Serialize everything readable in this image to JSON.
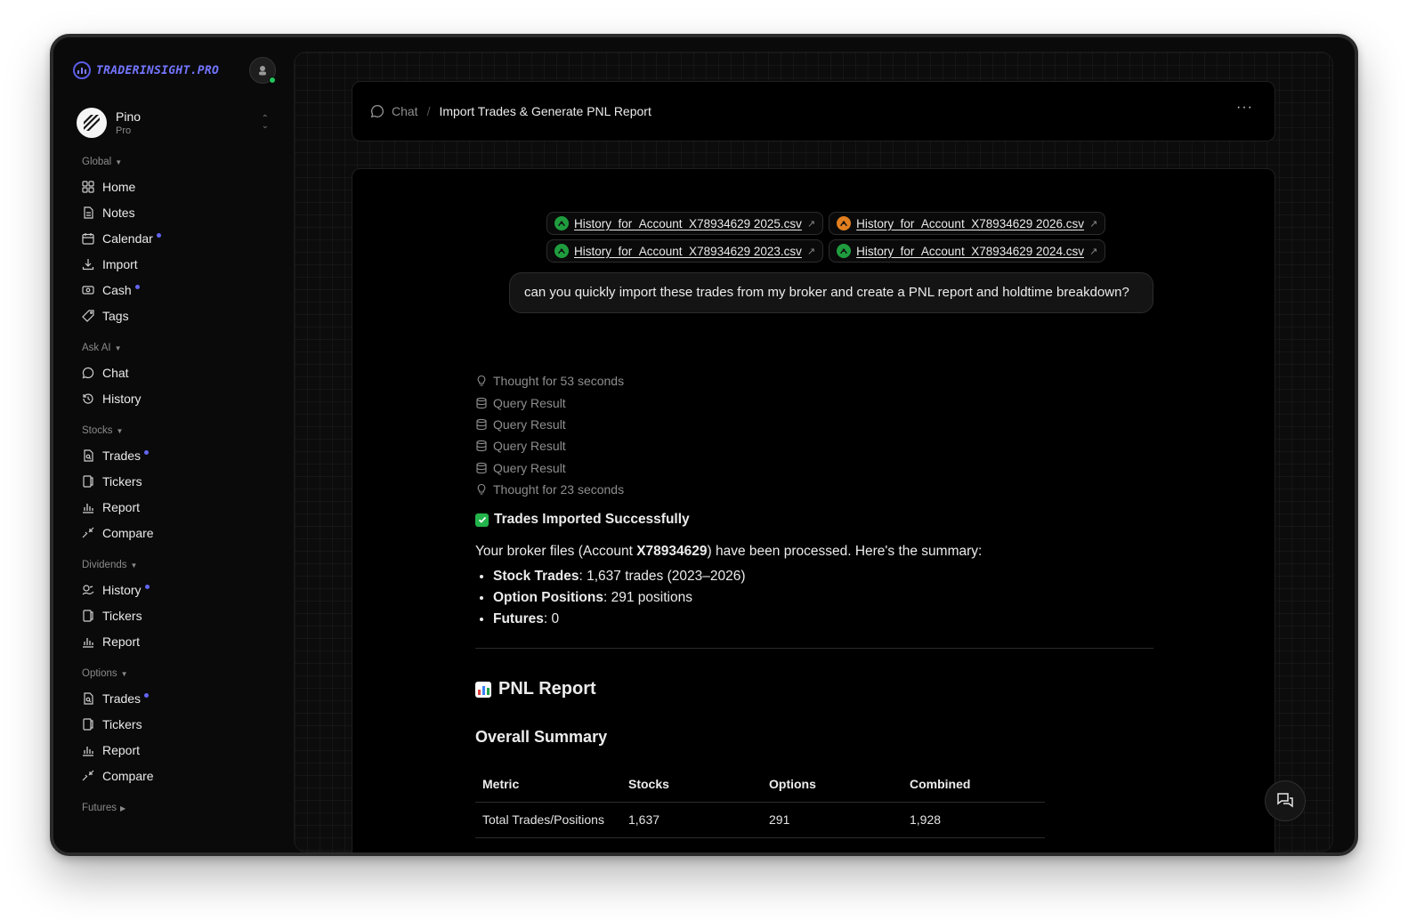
{
  "brand": {
    "name": "TRADERINSIGHT.PRO",
    "accent": "#7375ff"
  },
  "user": {
    "name": "Pino",
    "plan": "Pro"
  },
  "sidebar": {
    "global": {
      "label": "Global",
      "items": [
        {
          "label": "Home",
          "icon": "grid-icon"
        },
        {
          "label": "Notes",
          "icon": "note-icon"
        },
        {
          "label": "Calendar",
          "icon": "calendar-icon",
          "dot": true
        },
        {
          "label": "Import",
          "icon": "download-icon"
        },
        {
          "label": "Cash",
          "icon": "cash-icon",
          "dot": true
        },
        {
          "label": "Tags",
          "icon": "tag-icon"
        }
      ]
    },
    "ask_ai": {
      "label": "Ask AI",
      "items": [
        {
          "label": "Chat",
          "icon": "chat-icon"
        },
        {
          "label": "History",
          "icon": "history-icon"
        }
      ]
    },
    "stocks": {
      "label": "Stocks",
      "items": [
        {
          "label": "Trades",
          "icon": "trades-icon",
          "dot": true
        },
        {
          "label": "Tickers",
          "icon": "tickers-icon"
        },
        {
          "label": "Report",
          "icon": "report-icon"
        },
        {
          "label": "Compare",
          "icon": "compare-icon"
        }
      ]
    },
    "dividends": {
      "label": "Dividends",
      "items": [
        {
          "label": "History",
          "icon": "dividend-history-icon",
          "dot": true
        },
        {
          "label": "Tickers",
          "icon": "tickers-icon"
        },
        {
          "label": "Report",
          "icon": "report-icon"
        }
      ]
    },
    "options": {
      "label": "Options",
      "items": [
        {
          "label": "Trades",
          "icon": "trades-icon",
          "dot": true
        },
        {
          "label": "Tickers",
          "icon": "tickers-icon"
        },
        {
          "label": "Report",
          "icon": "report-icon"
        },
        {
          "label": "Compare",
          "icon": "compare-icon"
        }
      ]
    },
    "futures": {
      "label": "Futures"
    }
  },
  "header": {
    "crumb_root": "Chat",
    "crumb_current": "Import Trades & Generate PNL Report",
    "more": "···"
  },
  "files": [
    {
      "name": "History_for_Account_X78934629 2025.csv",
      "color": "green"
    },
    {
      "name": "History_for_Account_X78934629 2026.csv",
      "color": "orange"
    },
    {
      "name": "History_for_Account_X78934629 2023.csv",
      "color": "green"
    },
    {
      "name": "History_for_Account_X78934629 2024.csv",
      "color": "green"
    }
  ],
  "message": "can you quickly import these trades from my broker and create a PNL report and holdtime breakdown?",
  "steps": [
    {
      "label": "Thought for 53 seconds",
      "icon": "bulb-icon"
    },
    {
      "label": "Query Result",
      "icon": "database-icon"
    },
    {
      "label": "Query Result",
      "icon": "database-icon"
    },
    {
      "label": "Query Result",
      "icon": "database-icon"
    },
    {
      "label": "Query Result",
      "icon": "database-icon"
    },
    {
      "label": "Thought for 23 seconds",
      "icon": "bulb-icon"
    }
  ],
  "response": {
    "success_title": "Trades Imported Successfully",
    "summary_pre": "Your broker files (Account ",
    "summary_account": "X78934629",
    "summary_post": ") have been processed. Here's the summary:",
    "bullets": [
      {
        "label": "Stock Trades",
        "value": ": 1,637 trades (2023–2026)"
      },
      {
        "label": "Option Positions",
        "value": ": 291 positions"
      },
      {
        "label": "Futures",
        "value": ": 0"
      }
    ],
    "report_title": "PNL Report",
    "section_title": "Overall Summary",
    "table": {
      "headers": [
        "Metric",
        "Stocks",
        "Options",
        "Combined"
      ],
      "rows": [
        [
          "Total Trades/Positions",
          "1,637",
          "291",
          "1,928"
        ]
      ]
    }
  }
}
